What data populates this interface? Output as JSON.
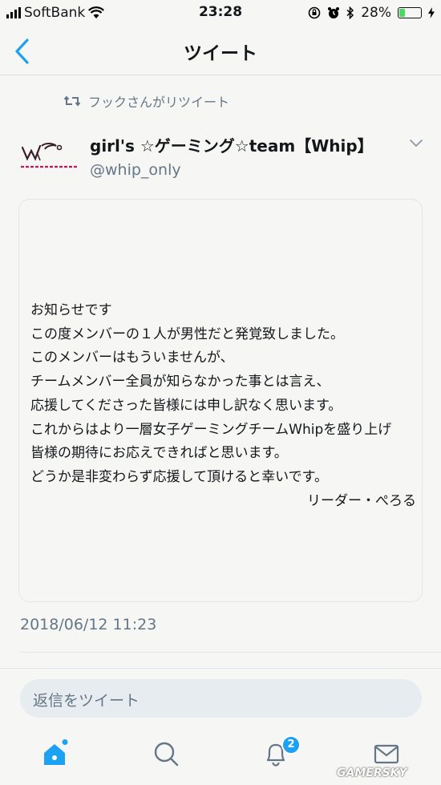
{
  "status_bar": {
    "carrier": "SoftBank",
    "time": "23:28",
    "battery": "28%",
    "battery_level": 0.28
  },
  "nav": {
    "title": "ツイート"
  },
  "tweet": {
    "retweeted_by": "フックさんがリツイート",
    "author_name": "girl's ☆ゲーミング☆team【Whip】",
    "author_handle": "@whip_only",
    "avatar_logo_text": "Girl's gaming team Whip",
    "lines": [
      "お知らせです",
      "この度メンバーの１人が男性だと発覚致しました。",
      "このメンバーはもういませんが、",
      "チームメンバー全員が知らなかった事とは言え、",
      "応援してくださった皆様には申し訳なく思います。",
      "これからはより一層女子ゲーミングチームWhipを盛り上げ",
      "皆様の期待にお応えできればと思います。",
      "どうか是非変わらず応援して頂けると幸いです。"
    ],
    "signature": "リーダー・ぺろる",
    "timestamp": "2018/06/12 11:23"
  },
  "reply": {
    "placeholder": "返信をツイート"
  },
  "tabs": {
    "notifications_badge": "2"
  },
  "watermark": "GAMERSKY",
  "colors": {
    "accent": "#1da1f2",
    "secondary_text": "#657786",
    "battery_fill": "#4cd964"
  }
}
